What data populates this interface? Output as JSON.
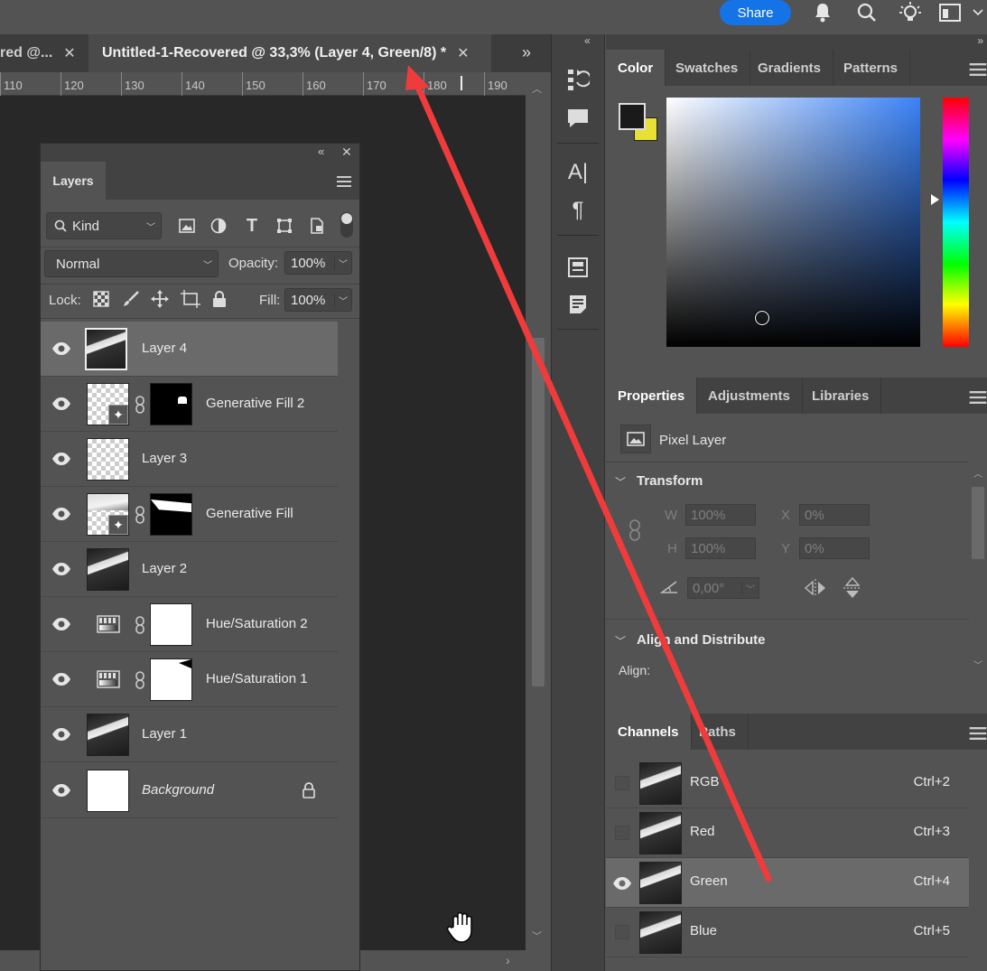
{
  "topbar": {
    "share_label": "Share",
    "icons": [
      "bell-icon",
      "search-icon",
      "lightbulb-icon",
      "workspace-icon",
      "chevron-down-icon"
    ]
  },
  "doc_tabs": [
    {
      "label": "red @...",
      "active": false
    },
    {
      "label": "Untitled-1-Recovered @ 33,3% (Layer 4, Green/8) *",
      "active": true
    }
  ],
  "ruler": {
    "ticks": [
      "110",
      "120",
      "130",
      "140",
      "150",
      "160",
      "170",
      "180",
      "190"
    ]
  },
  "layers_panel": {
    "tab_label": "Layers",
    "filter_kind": "Kind",
    "blend_mode": "Normal",
    "opacity_label": "Opacity:",
    "opacity_value": "100%",
    "lock_label": "Lock:",
    "fill_label": "Fill:",
    "fill_value": "100%",
    "layers": [
      {
        "name": "Layer 4",
        "type": "image",
        "selected": true
      },
      {
        "name": "Generative Fill 2",
        "type": "genfill"
      },
      {
        "name": "Layer 3",
        "type": "transparent"
      },
      {
        "name": "Generative Fill",
        "type": "genfill"
      },
      {
        "name": "Layer 2",
        "type": "image"
      },
      {
        "name": "Hue/Saturation 2",
        "type": "adjustment"
      },
      {
        "name": "Hue/Saturation 1",
        "type": "adjustment"
      },
      {
        "name": "Layer 1",
        "type": "image"
      },
      {
        "name": "Background",
        "type": "background",
        "locked": true
      }
    ]
  },
  "color_panel": {
    "tabs": [
      "Color",
      "Swatches",
      "Gradients",
      "Patterns"
    ],
    "foreground": "#1a1a1a",
    "background": "#e8e034",
    "hue_color": "#3b82f6"
  },
  "properties_panel": {
    "tabs": [
      "Properties",
      "Adjustments",
      "Libraries"
    ],
    "layer_kind": "Pixel Layer",
    "transform_title": "Transform",
    "w_label": "W",
    "w_value": "100%",
    "h_label": "H",
    "h_value": "100%",
    "x_label": "X",
    "x_value": "0%",
    "y_label": "Y",
    "y_value": "0%",
    "angle_value": "0,00°",
    "align_title": "Align and Distribute",
    "align_label": "Align:"
  },
  "channels_panel": {
    "tabs": [
      "Channels",
      "Paths"
    ],
    "channels": [
      {
        "name": "RGB",
        "shortcut": "Ctrl+2",
        "visible": false
      },
      {
        "name": "Red",
        "shortcut": "Ctrl+3",
        "visible": false
      },
      {
        "name": "Green",
        "shortcut": "Ctrl+4",
        "visible": true,
        "selected": true
      },
      {
        "name": "Blue",
        "shortcut": "Ctrl+5",
        "visible": false
      }
    ]
  },
  "annotation": {
    "arrow_color": "#ef3b3b"
  }
}
